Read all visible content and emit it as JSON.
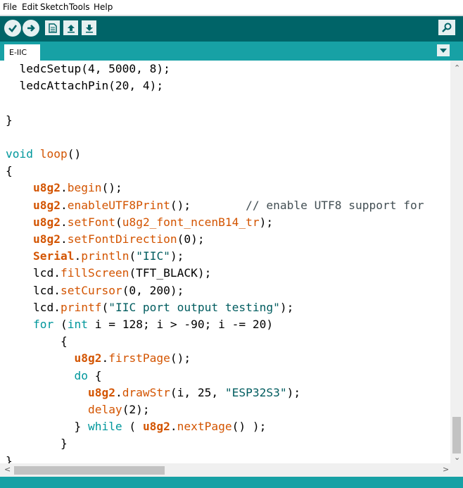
{
  "menu": [
    "File",
    "Edit",
    "Sketch",
    "Tools",
    "Help"
  ],
  "toolbar": {
    "buttons": [
      "verify-icon",
      "upload-icon",
      "new-icon",
      "open-icon",
      "save-icon"
    ],
    "right": "serial-monitor-icon"
  },
  "tab": {
    "label": "E-IIC"
  },
  "colors": {
    "toolbar": "#006468",
    "tabbar": "#17a1a5",
    "keyword": "#00979c",
    "function": "#d35400",
    "object": "#d35400"
  },
  "code_lines": [
    "  ledcSetup(4, 5000, 8);",
    "  ledcAttachPin(20, 4);",
    "",
    "}",
    "",
    "void loop()",
    "{",
    "    u8g2.begin();",
    "    u8g2.enableUTF8Print();        // enable UTF8 support for",
    "    u8g2.setFont(u8g2_font_ncenB14_tr);",
    "    u8g2.setFontDirection(0);",
    "    Serial.println(\"IIC\");",
    "    lcd.fillScreen(TFT_BLACK);",
    "    lcd.setCursor(0, 200);",
    "    lcd.printf(\"IIC port output testing\");",
    "    for (int i = 128; i > -90; i -= 20)",
    "        {",
    "          u8g2.firstPage();",
    "          do {",
    "            u8g2.drawStr(i, 25, \"ESP32S3\");",
    "            delay(2);",
    "          } while ( u8g2.nextPage() );",
    "        }",
    "}"
  ]
}
